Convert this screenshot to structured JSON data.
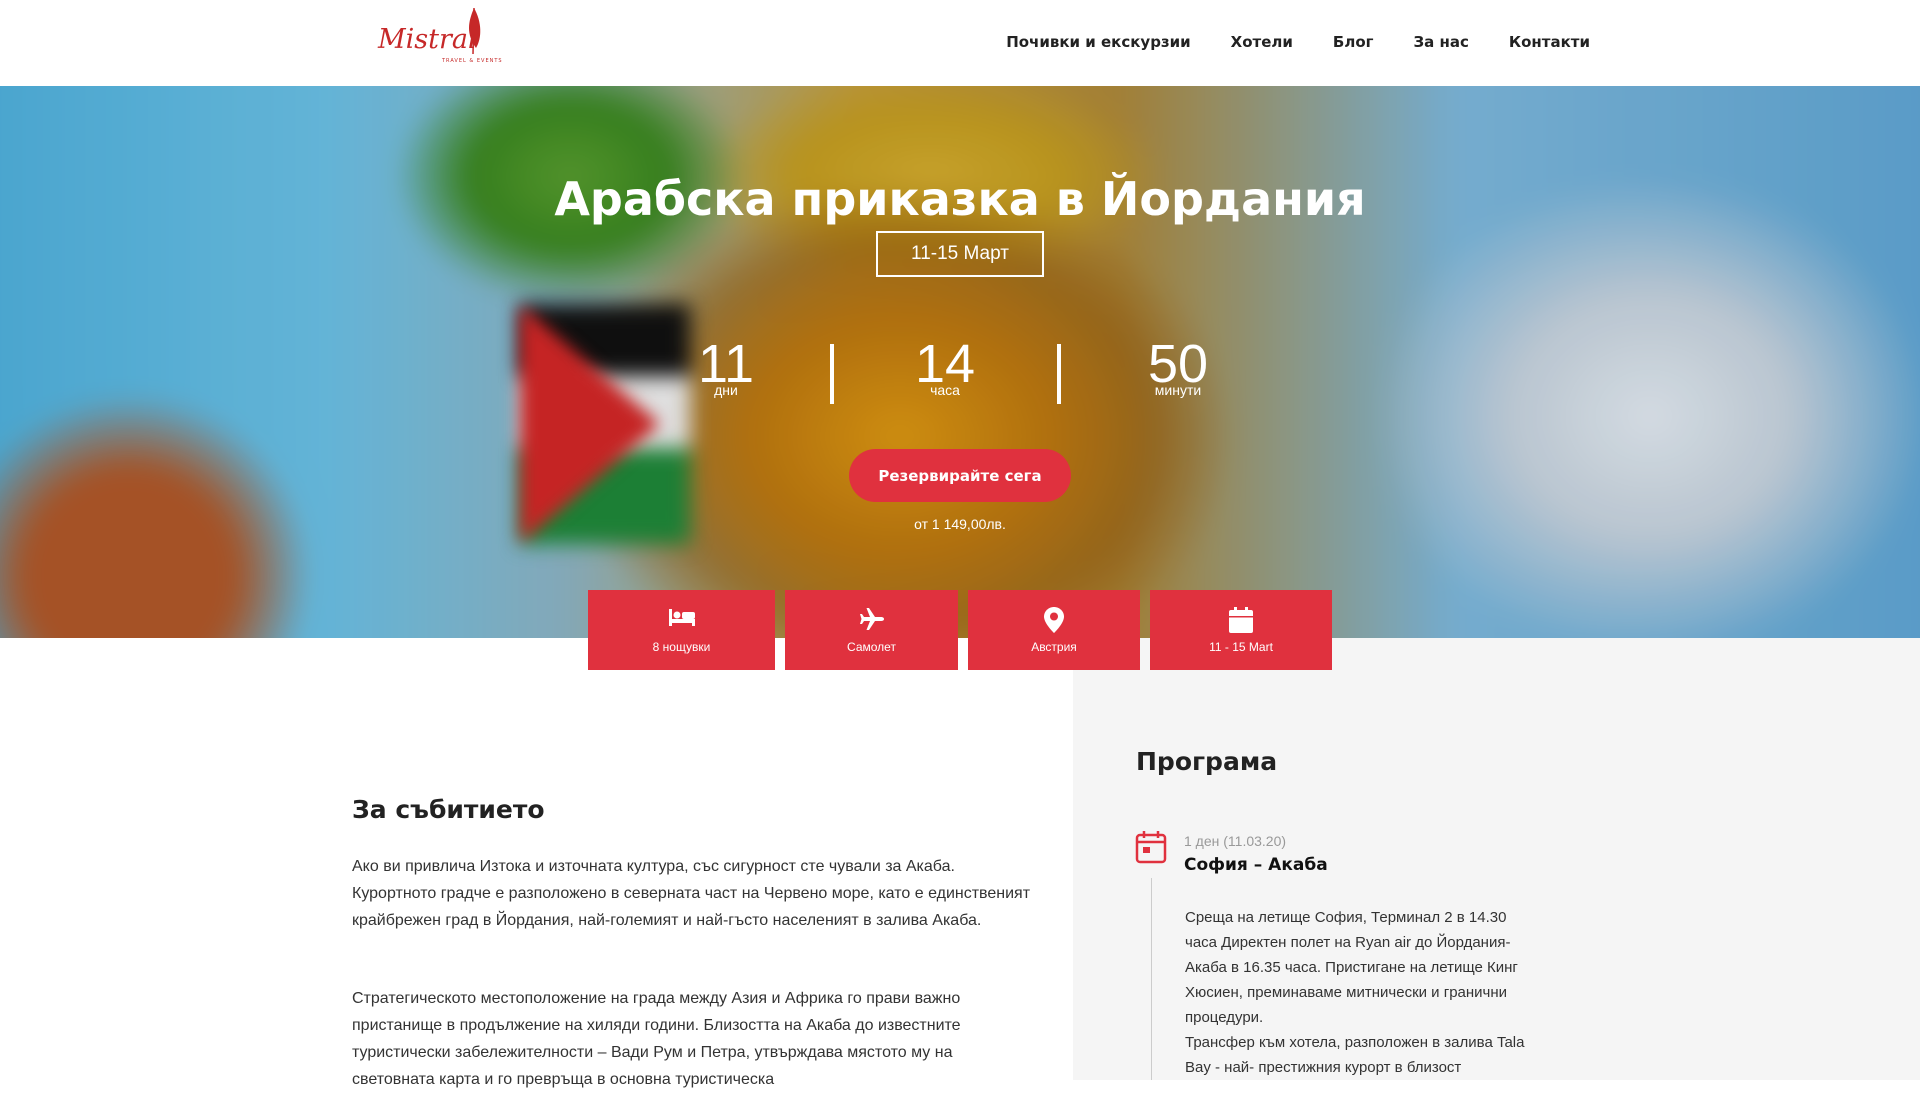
{
  "brand": {
    "logo_text": "Mistral",
    "logo_sub": "TRAVEL & EVENTS"
  },
  "nav": {
    "items": [
      "Почивки и екскурзии",
      "Хотели",
      "Блог",
      "За нас",
      "Контакти"
    ]
  },
  "hero": {
    "title": "Арабска приказка в Йордания",
    "date": "11-15 Март",
    "countdown": [
      {
        "value": "11",
        "label": "дни"
      },
      {
        "value": "14",
        "label": "часа"
      },
      {
        "value": "50",
        "label": "минути"
      }
    ],
    "book_label": "Резервирайте сега",
    "price": "от 1 149,00лв."
  },
  "tiles": [
    {
      "icon": "bed-icon",
      "label": "8 нощувки"
    },
    {
      "icon": "plane-icon",
      "label": "Самолет"
    },
    {
      "icon": "map-pin-icon",
      "label": "Австрия"
    },
    {
      "icon": "calendar-icon",
      "label": "11 - 15 Mart"
    }
  ],
  "event": {
    "heading": "За събитието",
    "paragraphs": [
      "Ако ви привлича Изтока и източната култура, със сигурност сте чували за Акаба. Курортното градче е разположено в северната част на Червено море, като е единственият крайбрежен град в Йордания, най-големият и най-гъсто населеният в залива Акаба.",
      "Стратегическото местоположение на града между Азия и Африка го прави важно пристанище в продължение на хиляди години. Близостта на Акаба до известните туристически забележителности – Вади Рум и Петра, утвърждава мястото му на световната карта и го превръща в основна туристическа"
    ]
  },
  "program": {
    "heading": "Програма",
    "day": {
      "meta": "1 ден (11.03.20)",
      "title": "София – Акаба",
      "text": [
        "Среща на летище София, Терминал 2 в 14.30 часа Директен полет на Ryan air до Йордания-Акаба в 16.35 часа. Пристигане на летище Кинг Хюсиен, преминаваме митнически и гранични процедури.",
        "Трансфер към хотела, разположен в залива Tala Bay - най- престижния курорт в близост"
      ]
    }
  },
  "colors": {
    "accent": "#e0313e",
    "panel": "#f5f5f5"
  }
}
